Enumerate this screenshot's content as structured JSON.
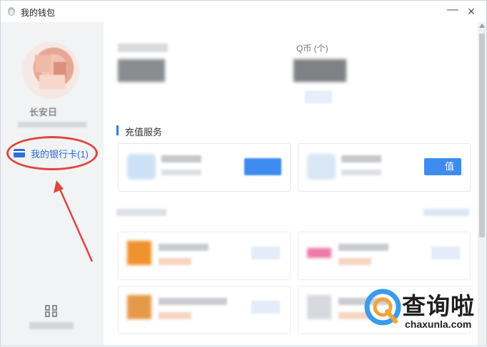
{
  "window": {
    "title": "我的钱包",
    "minimize_symbol": "—",
    "close_symbol": "✕"
  },
  "sidebar": {
    "username": "长安日",
    "bank_card_label": "我的银行卡(1)",
    "card_icon": "card-icon",
    "bottom_icon": "settings-icon"
  },
  "main": {
    "coin_label": "Q币 (个)",
    "section_title": "充值服务",
    "service_right_button": "值"
  },
  "watermark": {
    "text": "查询啦",
    "url": "chaxunla.com"
  },
  "colors": {
    "accent": "#2f7be0",
    "button_blue": "#3e8cf0",
    "annotation_red": "#e0453d"
  }
}
